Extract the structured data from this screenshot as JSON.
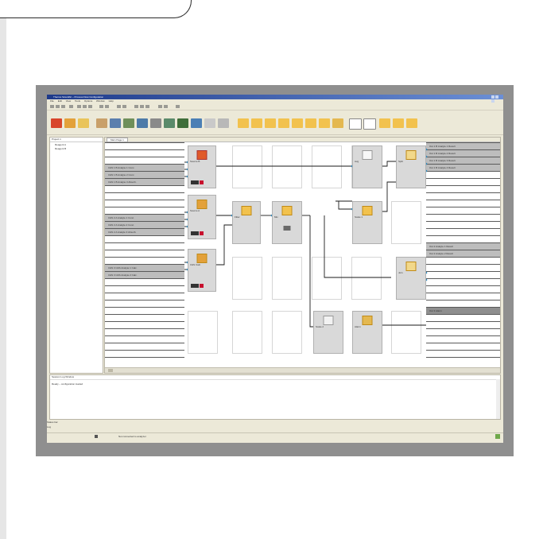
{
  "window": {
    "title": "Thermo Scientific – Process Flow Configuration",
    "menu": [
      "File",
      "Edit",
      "View",
      "Tools",
      "Options",
      "Window",
      "Help"
    ]
  },
  "tree": {
    "tab": "Project 1",
    "nodes": [
      "Reagent A",
      "Reagent B"
    ]
  },
  "diagram": {
    "tab": "Main Page 1",
    "inputs": [
      "C&S 1 B Analyte 1 Conc.",
      "C&S 1 B Analyte 2 Conc.",
      "C&S 1 B Analyte 3 Absorb.",
      "C&S 2 A Analyte 1 Conc.",
      "C&S 2 A Analyte 2 Conc.",
      "C&S 2 A Analyte 3 Absorb.",
      "C&S 3 C&S Analyte 1 Calc.",
      "C&S 3 C&S Analyte 2 Calc."
    ],
    "outputs": [
      "Out 1 B Analyte 1 Result",
      "Out 1 B Analyte 2 Result",
      "Out 1 B Analyte 3 Result",
      "Out 1 B Analyte 4 Result",
      "Out 2 Analyte 1 Result",
      "Out 2 Analyte 2 Result",
      "Out 3 Alarm"
    ],
    "blocks": [
      {
        "caption": "Source B"
      },
      {
        "caption": "Source A"
      },
      {
        "caption": "C&S Calc."
      },
      {
        "caption": "Filter"
      },
      {
        "caption": "Mix"
      },
      {
        "caption": "Avg"
      },
      {
        "caption": "Scale 1"
      },
      {
        "caption": "Scale 2"
      },
      {
        "caption": "Split"
      },
      {
        "caption": "Join"
      },
      {
        "caption": "Alarm"
      },
      {
        "caption": "Output"
      }
    ]
  },
  "log": {
    "header": "Session Log Window",
    "lines": [
      "Ready – configuration loaded"
    ]
  },
  "status": {
    "area_label": "Status bar",
    "tab": "Log",
    "message": "Not connected to analyzer"
  },
  "colors": {
    "frame": "#8f8f8f",
    "window": "#ece9d8",
    "titlebar": "#1e3a8a",
    "block": "#d9d9d9",
    "wire": "#3a6fb0",
    "marker": "#c8102e"
  }
}
